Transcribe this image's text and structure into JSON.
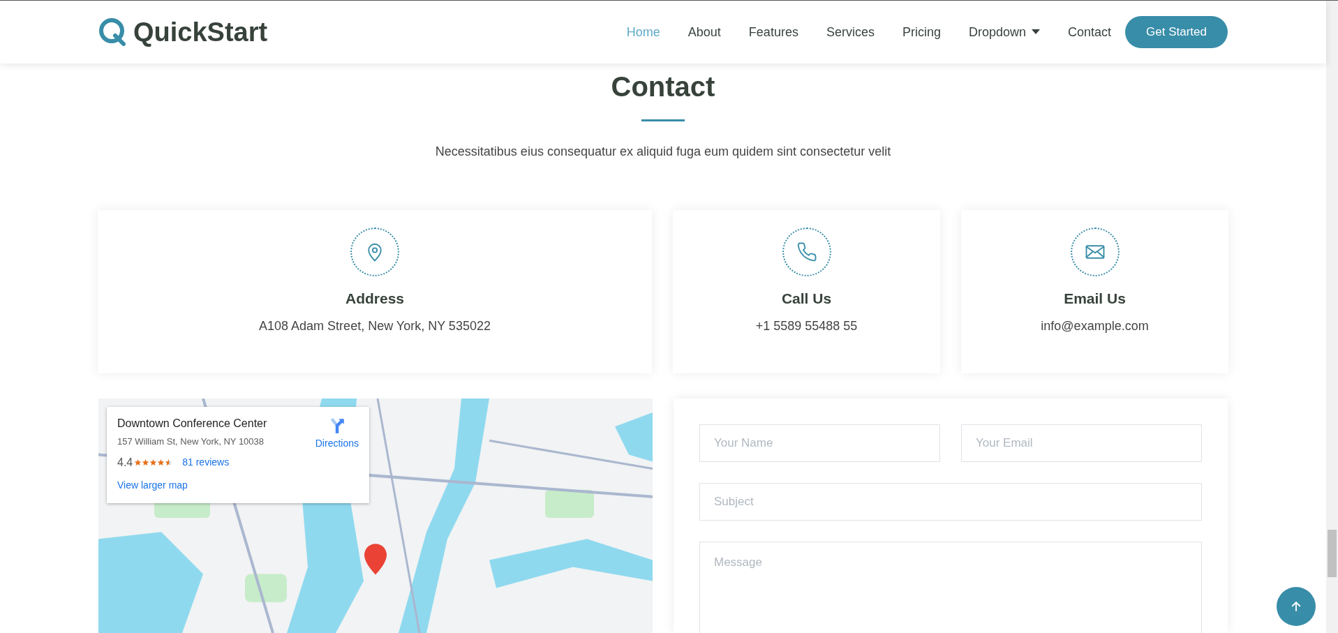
{
  "header": {
    "logo_text": "QuickStart",
    "nav": [
      {
        "label": "Home",
        "selected": true
      },
      {
        "label": "About",
        "selected": false
      },
      {
        "label": "Features",
        "selected": false
      },
      {
        "label": "Services",
        "selected": false
      },
      {
        "label": "Pricing",
        "selected": false
      },
      {
        "label": "Dropdown",
        "selected": false,
        "kind": "dropdown"
      },
      {
        "label": "Contact",
        "selected": false
      }
    ],
    "cta": "Get Started"
  },
  "section": {
    "title": "Contact",
    "subtitle": "Necessitatibus eius consequatur ex aliquid fuga eum quidem sint consectetur velit"
  },
  "info_cards": [
    {
      "kind": "address",
      "title": "Address",
      "text": "A108 Adam Street, New York, NY 535022"
    },
    {
      "kind": "phone",
      "title": "Call Us",
      "text": "+1 5589 55488 55"
    },
    {
      "kind": "email",
      "title": "Email Us",
      "text": "info@example.com"
    }
  ],
  "map": {
    "place": "Downtown Conference Center",
    "address": "157 William St, New York, NY 10038",
    "rating": "4.4",
    "stars": 4.5,
    "reviews": "81 reviews",
    "larger_map": "View larger map",
    "directions": "Directions"
  },
  "form": {
    "fields": [
      {
        "placeholder": "Your Name",
        "kind": "half"
      },
      {
        "placeholder": "Your Email",
        "kind": "half"
      },
      {
        "placeholder": "Subject",
        "kind": "full"
      },
      {
        "placeholder": "Message",
        "kind": "textarea"
      }
    ]
  }
}
